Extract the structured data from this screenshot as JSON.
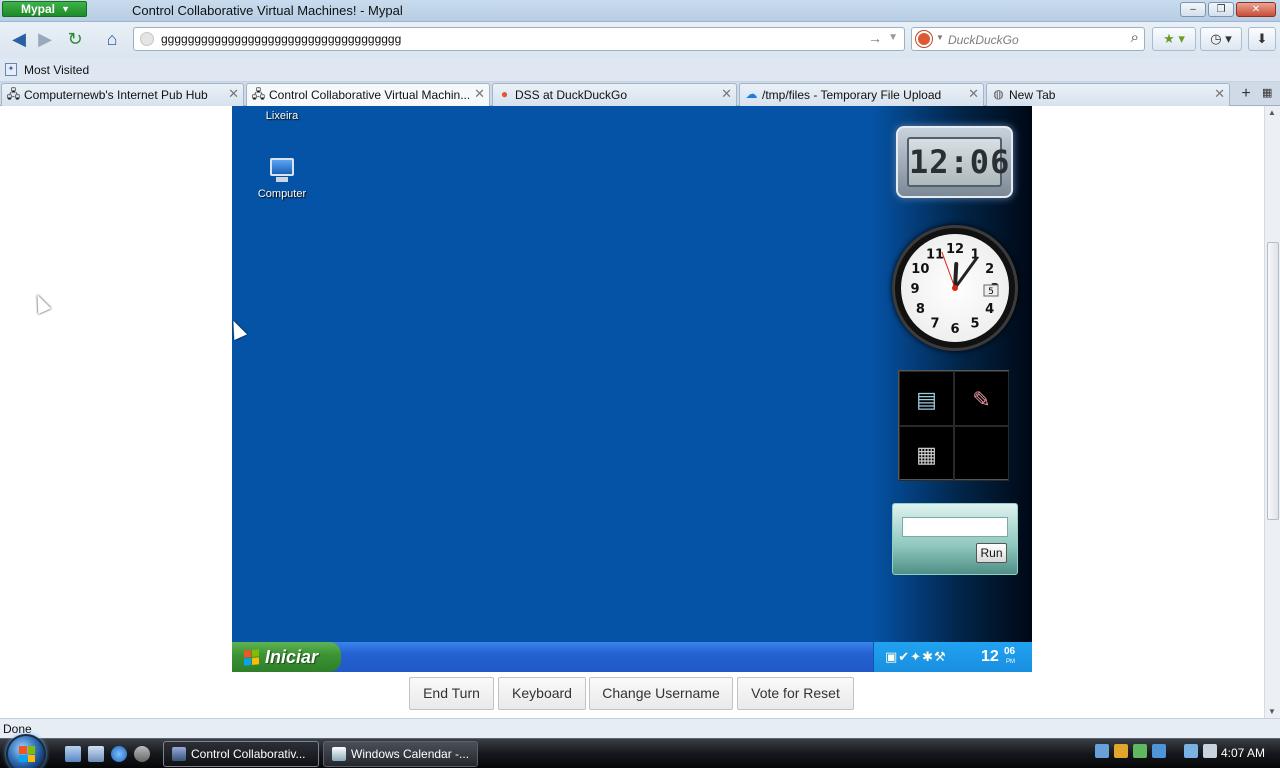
{
  "window": {
    "app_button": "Mypal",
    "title": "Control Collaborative Virtual Machines! - Mypal",
    "controls": [
      "–",
      "❐",
      "✕"
    ]
  },
  "navbar": {
    "url": "gggggggggggggggggggggggggggggggggggg",
    "search_placeholder": "DuckDuckGo",
    "icons": [
      "back-icon",
      "forward-icon",
      "reload-icon",
      "home-icon",
      "bookmark-star-icon",
      "history-icon",
      "download-icon"
    ]
  },
  "bookmarks": {
    "items": [
      {
        "label": "Most Visited"
      }
    ]
  },
  "tabs": [
    {
      "label": "Computernewb's Internet Pub Hub",
      "icon": "vm-icon",
      "active": false
    },
    {
      "label": "Control Collaborative Virtual Machin...",
      "icon": "vm-icon",
      "active": true
    },
    {
      "label": "DSS at DuckDuckGo",
      "icon": "duckduckgo-icon",
      "active": false
    },
    {
      "label": "/tmp/files - Temporary File Upload",
      "icon": "cloud-upload-icon",
      "active": false
    },
    {
      "label": "New Tab",
      "icon": "globe-icon",
      "active": false
    }
  ],
  "vm": {
    "desktop_icons": [
      {
        "label": "Lixeira"
      },
      {
        "label": "Computer"
      }
    ],
    "digital_clock": "12:06",
    "analog_clock": {
      "hour": 12,
      "minute": 6,
      "date": "5"
    },
    "run_gadget": {
      "button": "Run"
    },
    "start_button": "Iniciar",
    "tray_time": "12",
    "tray_time_minutes": "06",
    "tray_ampm": "PM"
  },
  "vm_controls": {
    "end_turn": "End Turn",
    "keyboard": "Keyboard",
    "change_username": "Change Username",
    "vote_reset": "Vote for Reset"
  },
  "statusbar": {
    "text": "Done"
  },
  "os_taskbar": {
    "tasks": [
      {
        "label": "Control Collaborativ...",
        "active": true
      },
      {
        "label": "Windows Calendar -...",
        "active": false
      }
    ],
    "clock": "4:07 AM"
  },
  "colors": {
    "vm_desktop": "#0553a6",
    "xp_start": "#3a9233",
    "xp_taskbar": "#2461d1",
    "mypal_green": "#1e8a29"
  }
}
